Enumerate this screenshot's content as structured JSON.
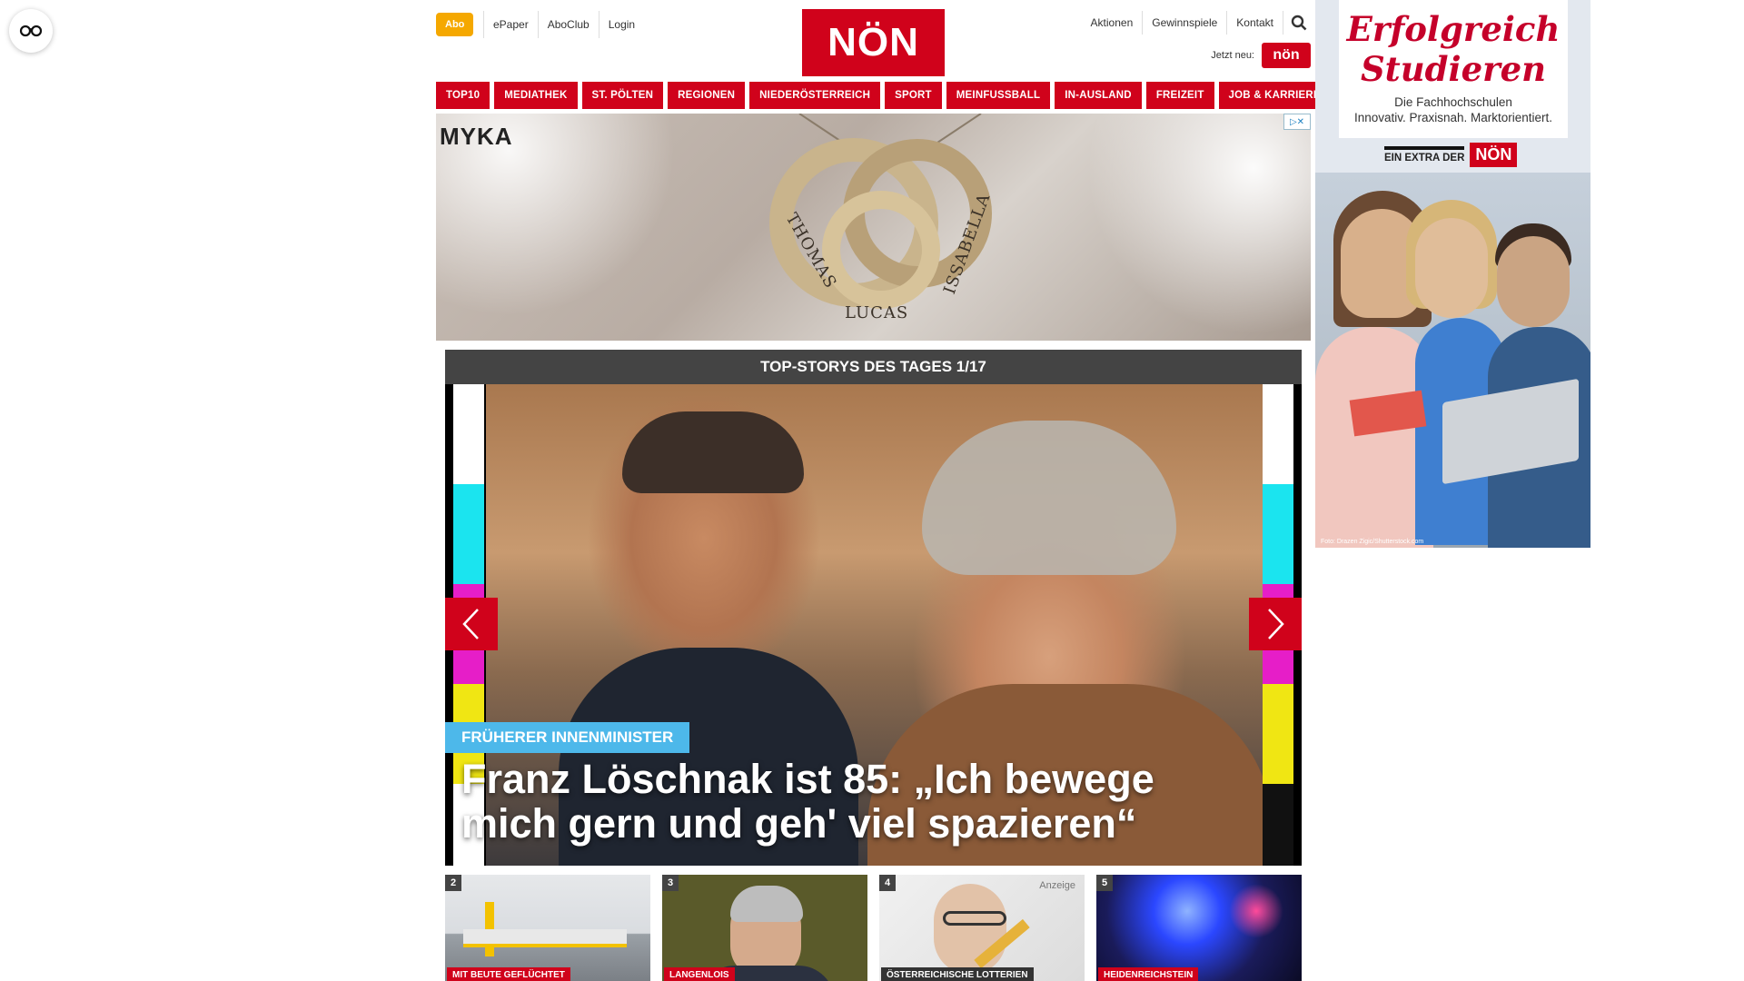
{
  "accessibility": {
    "icon": "glasses-icon"
  },
  "header": {
    "abo_label": "Abo",
    "util_links": [
      "ePaper",
      "AboClub",
      "Login"
    ],
    "logo_text": "NÖN",
    "right_links": [
      "Aktionen",
      "Gewinnspiele",
      "Kontakt"
    ],
    "search_icon": "search-icon",
    "jetzt_label": "Jetzt neu:",
    "jetzt_logo": "nön"
  },
  "nav": [
    "TOP10",
    "MEDIATHEK",
    "ST. PÖLTEN",
    "REGIONEN",
    "NIEDERÖSTERREICH",
    "SPORT",
    "MEINFUSSBALL",
    "IN-AUSLAND",
    "FREIZEIT",
    "JOB & KARRIERE"
  ],
  "banner_ad": {
    "brand": "MYKA",
    "names": [
      "THOMAS",
      "LUCAS",
      "ISSABELLA"
    ],
    "adchoice": "▷✕"
  },
  "carousel": {
    "header": "TOP-STORYS DES TAGES 1/17",
    "kicker": "FRÜHERER INNENMINISTER",
    "headline": "Franz Löschnak ist 85: „Ich bewege mich gern und geh' viel spazieren“"
  },
  "thumbs": [
    {
      "num": "2",
      "category": "MIT BEUTE GEFLÜCHTET",
      "ad": ""
    },
    {
      "num": "3",
      "category": "LANGENLOIS",
      "ad": ""
    },
    {
      "num": "4",
      "category": "ÖSTERREICHISCHE LOTTERIEN",
      "ad": "Anzeige"
    },
    {
      "num": "5",
      "category": "HEIDENREICHSTEIN",
      "ad": ""
    }
  ],
  "sky_ad": {
    "title_line1": "Erfolgreich",
    "title_line2": "Studieren",
    "subtitle_line1": "Die Fachhochschulen",
    "subtitle_line2": "Innovativ. Praxisnah. Marktorientiert.",
    "extra_label": "EIN EXTRA DER",
    "extra_logo": "NÖN",
    "credit": "Foto: Drazen Zigic/Shutterstock.com"
  },
  "colors": {
    "brand_red": "#d0021b",
    "abo_orange": "#f5a800",
    "kicker_blue": "#4db8ea",
    "header_dark": "#444444"
  }
}
